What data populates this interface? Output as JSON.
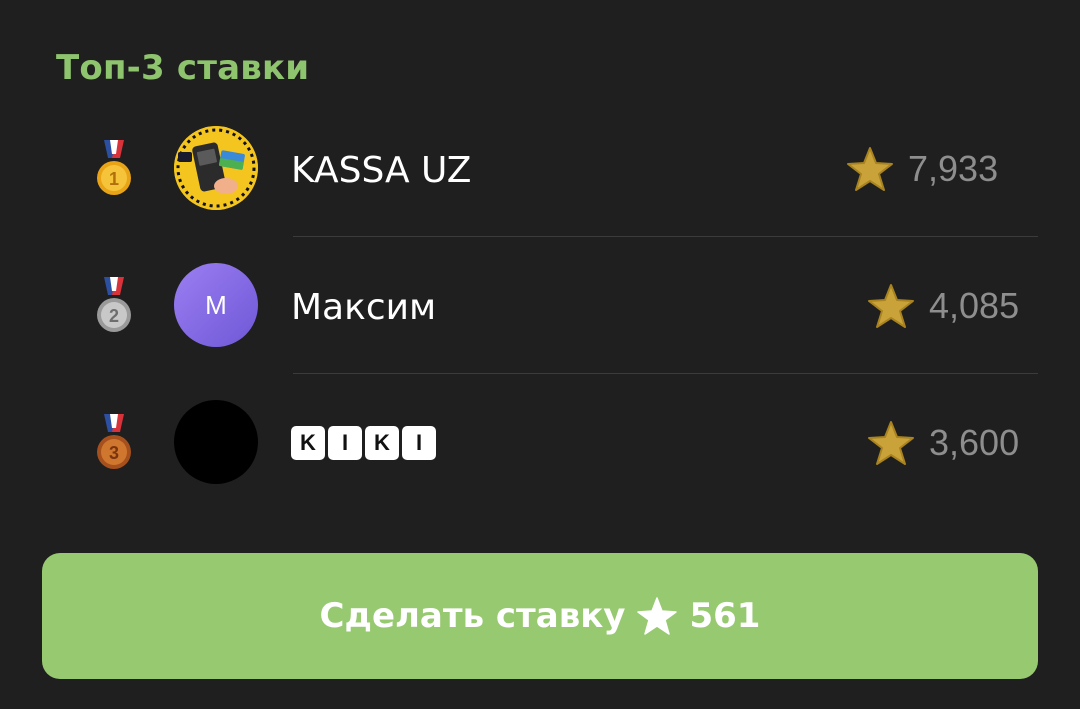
{
  "section": {
    "title": "Топ-3 ставки"
  },
  "leaderboard": [
    {
      "rank": 1,
      "medal": "gold-medal-icon",
      "avatar": "kassa-uz-avatar",
      "name": "KASSA UZ",
      "score": "7,933"
    },
    {
      "rank": 2,
      "medal": "silver-medal-icon",
      "avatar_letter": "M",
      "name": "Максим",
      "score": "4,085"
    },
    {
      "rank": 3,
      "medal": "bronze-medal-icon",
      "avatar": "black-avatar",
      "name_letters": [
        "K",
        "I",
        "K",
        "I"
      ],
      "score": "3,600"
    }
  ],
  "button": {
    "label": "Сделать ставку",
    "amount": "561"
  },
  "colors": {
    "background": "#1f1f1f",
    "accent_green": "#8fc46e",
    "button_green": "#97c971",
    "score_gray": "#8e8e8e",
    "star_gold": "#c9a23a"
  }
}
